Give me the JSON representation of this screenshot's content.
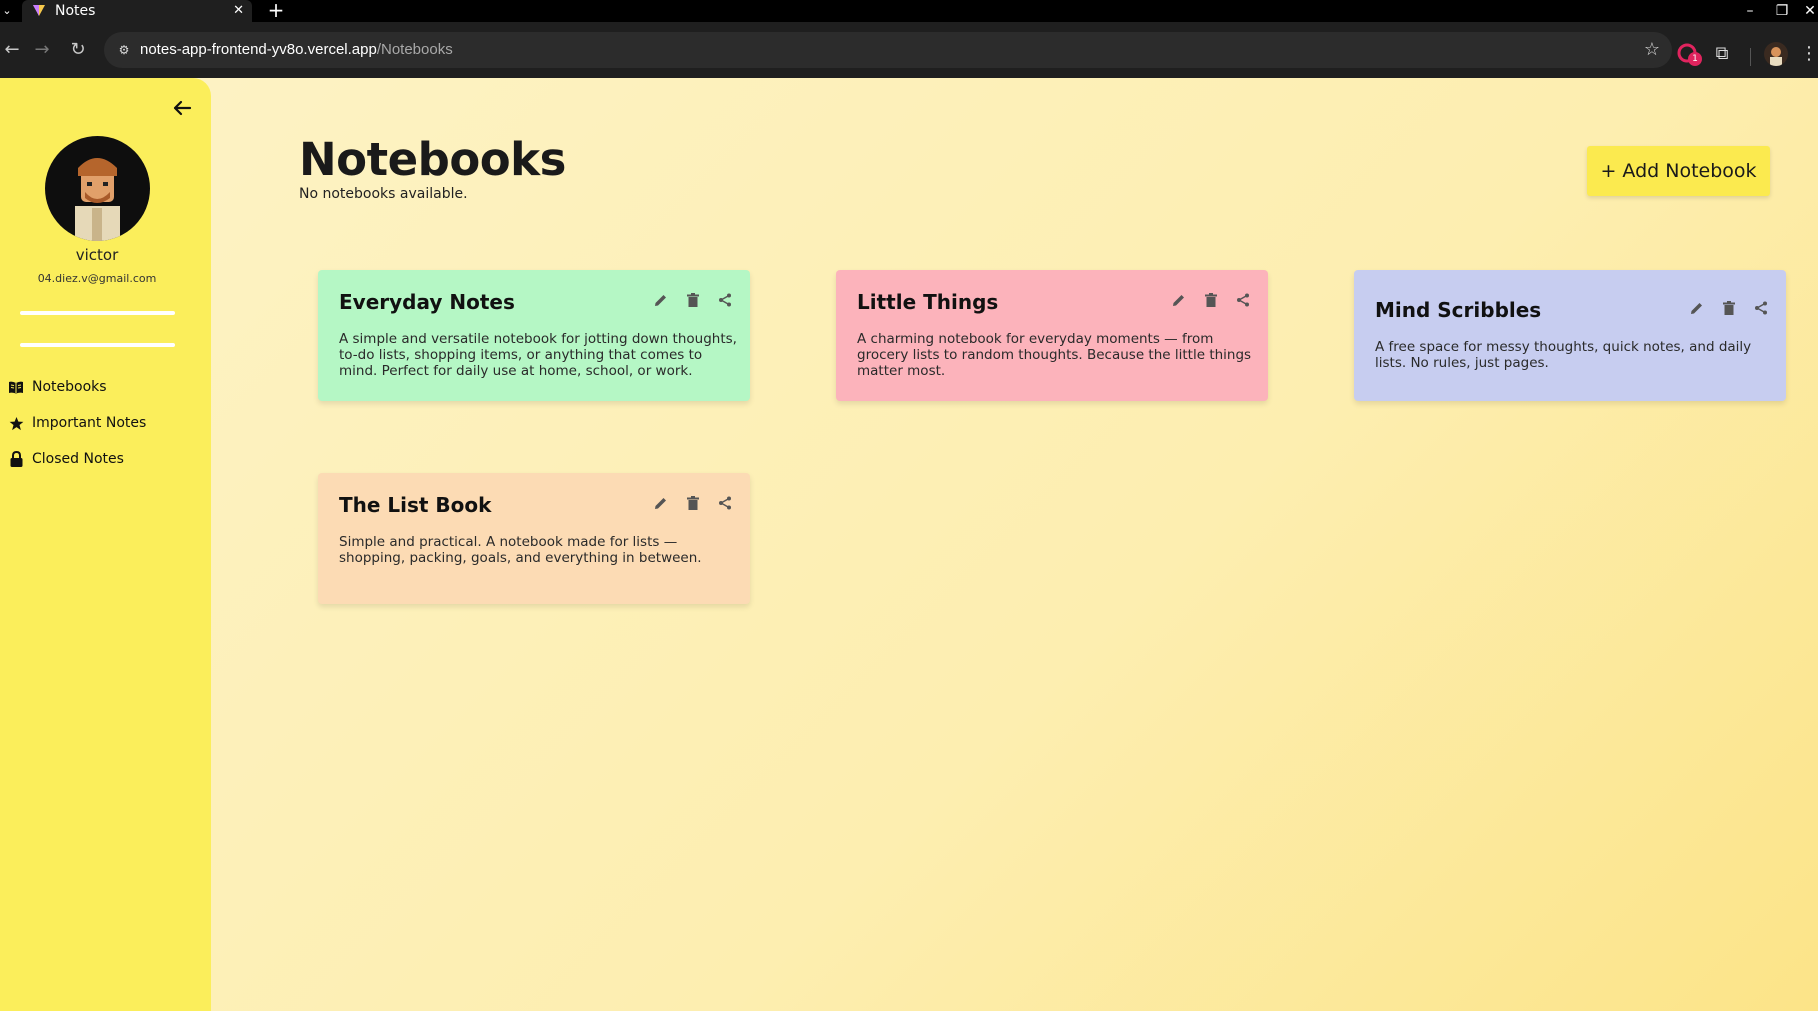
{
  "browser": {
    "tab_title": "Notes",
    "url_domain": "notes-app-frontend-yv8o.vercel.app",
    "url_path": "/Notebooks",
    "extension_badge": "1"
  },
  "sidebar": {
    "user": {
      "name": "victor",
      "email": "04.diez.v@gmail.com"
    },
    "nav": [
      {
        "label": "Notebooks",
        "icon": "book-open-icon"
      },
      {
        "label": "Important Notes",
        "icon": "star-icon"
      },
      {
        "label": "Closed Notes",
        "icon": "lock-icon"
      }
    ]
  },
  "main": {
    "title": "Notebooks",
    "empty_message": "No notebooks available.",
    "add_button_label": "+ Add Notebook"
  },
  "notebooks": [
    {
      "title": "Everyday Notes",
      "description": "A simple and versatile notebook for jotting down thoughts, to-do lists, shopping items, or anything that comes to mind. Perfect for daily use at home, school, or work.",
      "color": "#b5f7c5"
    },
    {
      "title": "Little Things",
      "description": "A charming notebook for everyday moments — from grocery lists to random thoughts. Because the little things matter most.",
      "color": "#fcb3bb"
    },
    {
      "title": "Mind Scribbles",
      "description": "A free space for messy thoughts, quick notes, and daily lists. No rules, just pages.",
      "color": "#c7cdf0"
    },
    {
      "title": "The List Book",
      "description": "Simple and practical. A notebook made for lists — shopping, packing, goals, and everything in between.",
      "color": "#fcdbb4"
    }
  ],
  "colors": {
    "sidebar": "#fbee5b",
    "add_button": "#fbea4f",
    "page_background": "#fdf1bd"
  }
}
